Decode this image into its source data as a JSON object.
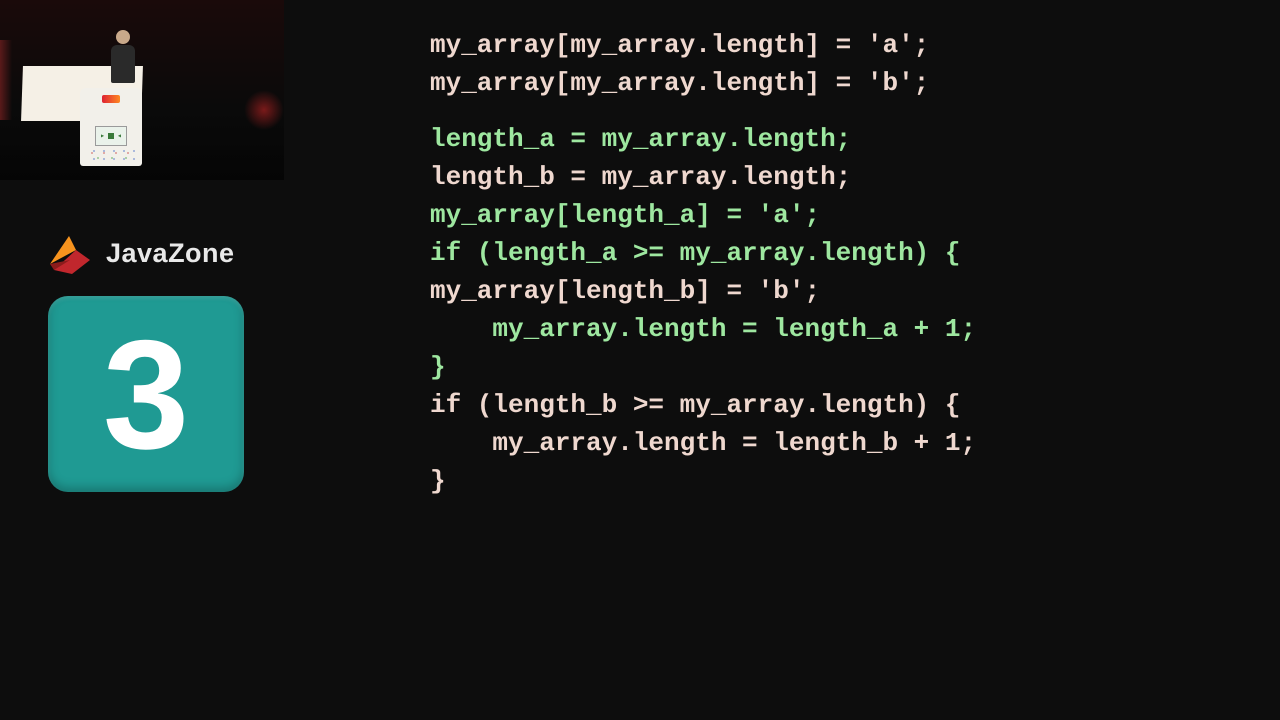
{
  "brand": {
    "name": "JavaZone"
  },
  "badge": {
    "number": "3"
  },
  "code": {
    "top": [
      "my_array[my_array.length] = 'a';",
      "my_array[my_array.length] = 'b';"
    ],
    "body": [
      {
        "text": "length_a = my_array.length;",
        "cls": "c-green"
      },
      {
        "text": "length_b = my_array.length;",
        "cls": "c-pink"
      },
      {
        "text": "my_array[length_a] = 'a';",
        "cls": "c-green"
      },
      {
        "text": "if (length_a >= my_array.length) {",
        "cls": "c-green"
      },
      {
        "text": "my_array[length_b] = 'b';",
        "cls": "c-pink"
      },
      {
        "text": "    my_array.length = length_a + 1;",
        "cls": "c-green"
      },
      {
        "text": "}",
        "cls": "c-green"
      },
      {
        "text": "if (length_b >= my_array.length) {",
        "cls": "c-pink"
      },
      {
        "text": "    my_array.length = length_b + 1;",
        "cls": "c-pink"
      },
      {
        "text": "}",
        "cls": "c-pink"
      }
    ]
  }
}
